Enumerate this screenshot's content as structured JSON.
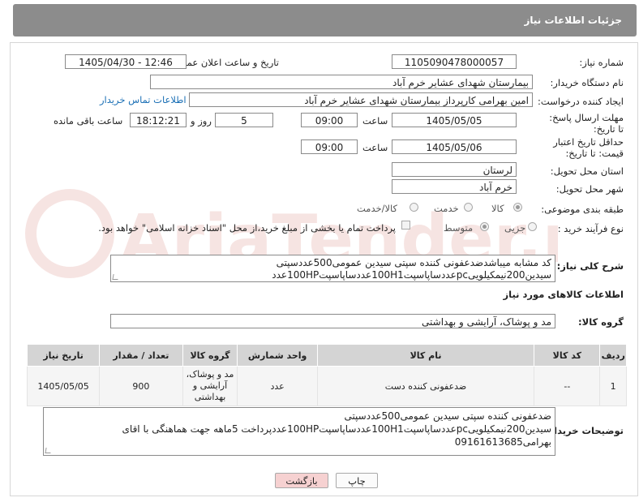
{
  "window_title": "جزئیات اطلاعات نیاز",
  "fields": {
    "need_number_label": "شماره نیاز:",
    "need_number": "1105090478000057",
    "announce_label": "تاریخ و ساعت اعلان عمومی:",
    "announce_value": "1405/04/30 - 12:46",
    "buyer_org_label": "نام دستگاه خریدار:",
    "buyer_org": "بیمارستان شهدای عشایر خرم آباد",
    "creator_label": "ایجاد کننده درخواست:",
    "creator": "امین بهرامی کارپرداز بیمارستان شهدای عشایر خرم آباد",
    "contact_link": "اطلاعات تماس خریدار",
    "deadline_label": "مهلت ارسال پاسخ: تا تاریخ:",
    "deadline_date": "1405/05/05",
    "time_label": "ساعت",
    "deadline_time": "09:00",
    "days_value": "5",
    "days_label": "روز و",
    "remaining_time": "18:12:21",
    "remaining_label": "ساعت باقی مانده",
    "validity_label": "حداقل تاریخ اعتبار قیمت: تا تاریخ:",
    "validity_date": "1405/05/06",
    "validity_time": "09:00",
    "province_label": "استان محل تحویل:",
    "province": "لرستان",
    "city_label": "شهر محل تحویل:",
    "city": "خرم آباد",
    "category_label": "طبقه بندی موضوعی:",
    "category_options": [
      "کالا",
      "خدمت",
      "کالا/خدمت"
    ],
    "process_label": "نوع فرآیند خرید :",
    "process_options": [
      "جزیی",
      "متوسط"
    ],
    "payment_note": "پرداخت تمام یا بخشی از مبلغ خرید،از محل \"اسناد خزانه اسلامی\" خواهد بود.",
    "general_desc_label": "شرح کلی نیاز:",
    "general_desc": "کد مشابه میباشدضدعفونی کننده سپتی سیدین عمومی500عددسپتی سیدین200نیمکیلوییpcعددساپاسپت100H1عددساپاسپت100HPعدد"
  },
  "goods_info_title": "اطلاعات کالاهای مورد نیاز",
  "goods_group_label": "گروه کالا:",
  "goods_group": "مد و پوشاک، آرایشی و بهداشتی",
  "table": {
    "headers": [
      "ردیف",
      "کد کالا",
      "نام کالا",
      "واحد شمارش",
      "گروه کالا",
      "تعداد / مقدار",
      "تاریخ نیاز"
    ],
    "rows": [
      [
        "1",
        "--",
        "ضدعفونی کننده دست",
        "عدد",
        "مد و پوشاک، آرایشی و بهداشتی",
        "900",
        "1405/05/05"
      ]
    ]
  },
  "buyer_notes_label": "توضیحات خریدار:",
  "buyer_notes": "ضدعفونی کننده سپتی سیدین عمومی500عددسپتی سیدین200نیمکیلوییpcعددساپاسپت100H1عددساپاسپت100HPعددپرداخت 5ماهه جهت هماهنگی با اقای بهرامی09161613685",
  "buttons": {
    "print": "چاپ",
    "back": "بازگشت"
  },
  "watermark_text": "AriaTender.net",
  "colors": {
    "titlebar": "#8c8c8c",
    "link": "#1a6fb5",
    "back_button_bg": "#f6d1d1",
    "watermark": "#c0392b"
  }
}
